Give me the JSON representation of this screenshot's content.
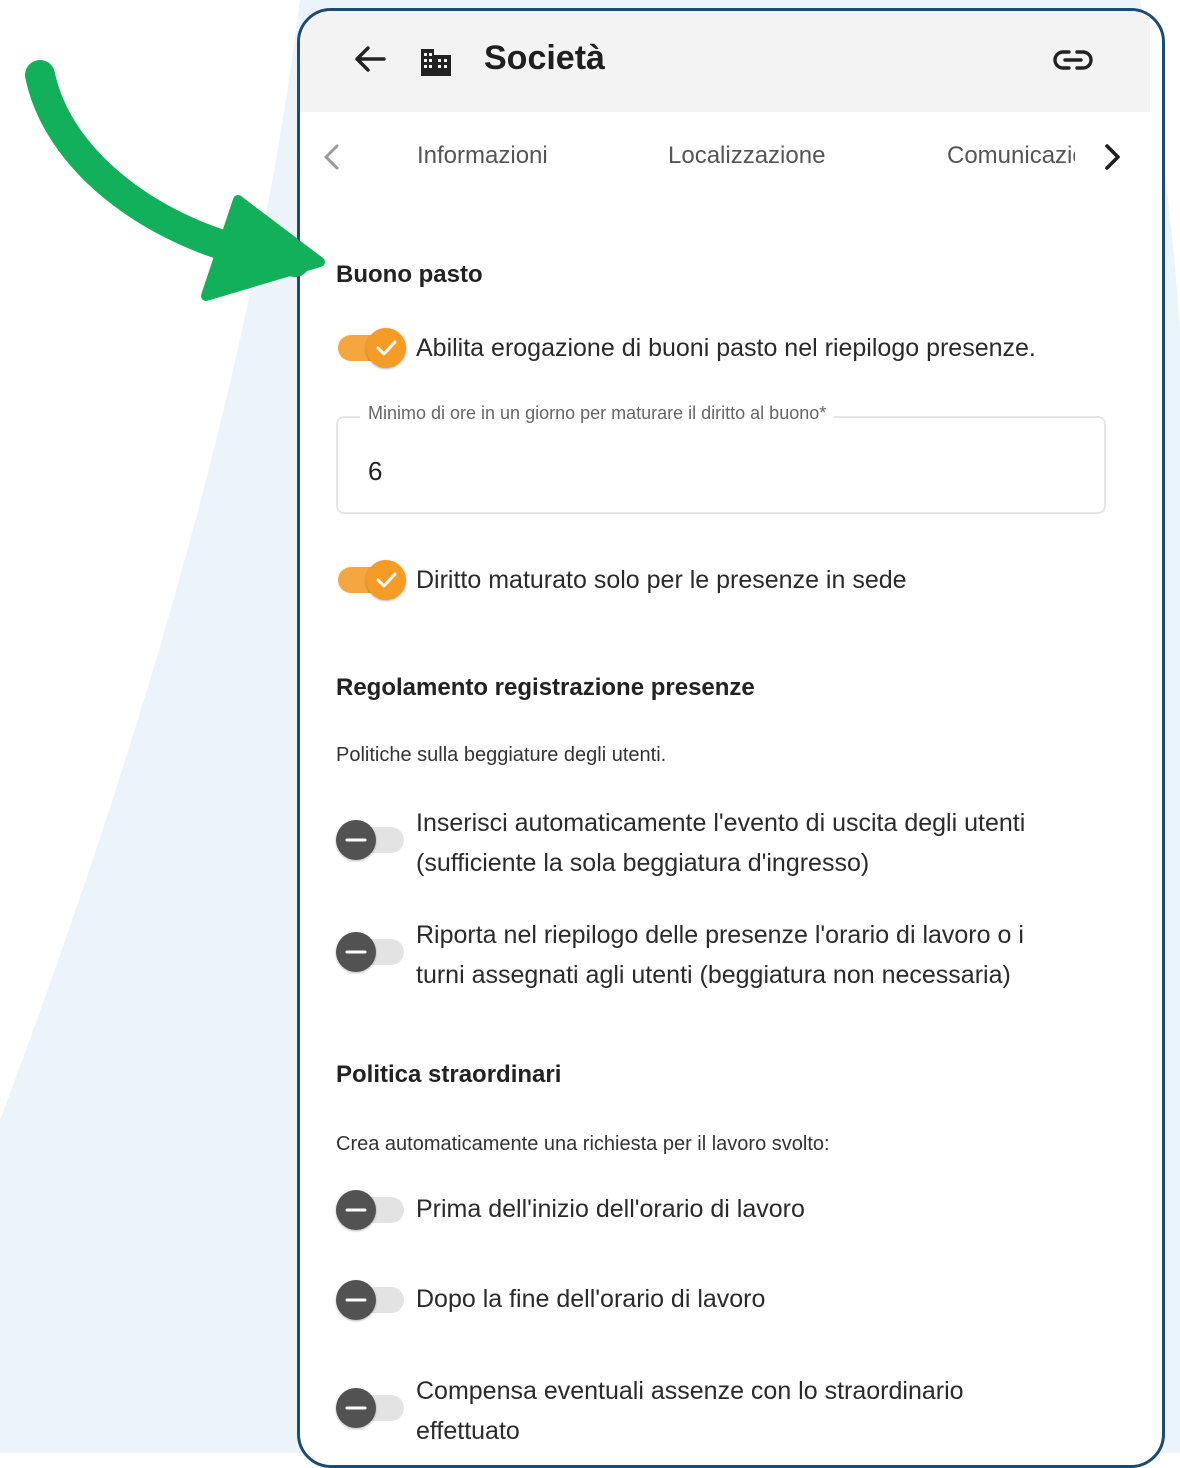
{
  "colors": {
    "background_shape": "#ebf3fb",
    "arrow": "#12b05a",
    "phone_border": "#1f4a72",
    "toggle_on": "#f49c26",
    "toggle_off_knob": "#525252"
  },
  "header": {
    "back_icon": "arrow-left-icon",
    "building_icon": "building-icon",
    "title": "Società",
    "link_icon": "link-icon"
  },
  "tabs": {
    "items": [
      "Informazioni",
      "Localizzazione",
      "Comunicazione"
    ],
    "prev_icon": "chevron-left-icon",
    "next_icon": "chevron-right-icon"
  },
  "meal_voucher": {
    "title": "Buono pasto",
    "enable_toggle": {
      "label": "Abilita erogazione di buoni pasto nel riepilogo presenze.",
      "on": true
    },
    "min_hours_field": {
      "label": "Minimo di ore in un giorno per maturare il diritto al buono*",
      "value": "6"
    },
    "onsite_toggle": {
      "label": "Diritto maturato solo per le presenze in sede",
      "on": true
    }
  },
  "attendance_rules": {
    "title": "Regolamento registrazione presenze",
    "description": "Politiche sulla beggiature degli utenti.",
    "toggles": [
      {
        "line1": "Inserisci automaticamente l'evento di uscita degli utenti",
        "line2": "(sufficiente la sola beggiatura d'ingresso)",
        "on": false
      },
      {
        "line1": "Riporta nel riepilogo delle presenze l'orario di lavoro o i",
        "line2": "turni assegnati agli utenti (beggiatura non necessaria)",
        "on": false
      }
    ]
  },
  "overtime": {
    "title": "Politica straordinari",
    "description": "Crea automaticamente una richiesta per il lavoro svolto:",
    "toggles": [
      {
        "line1": "Prima dell'inizio dell'orario di lavoro",
        "on": false
      },
      {
        "line1": "Dopo la fine dell'orario di lavoro",
        "on": false
      },
      {
        "line1": "Compensa eventuali assenze con lo straordinario",
        "line2": "effettuato",
        "on": false
      }
    ]
  }
}
